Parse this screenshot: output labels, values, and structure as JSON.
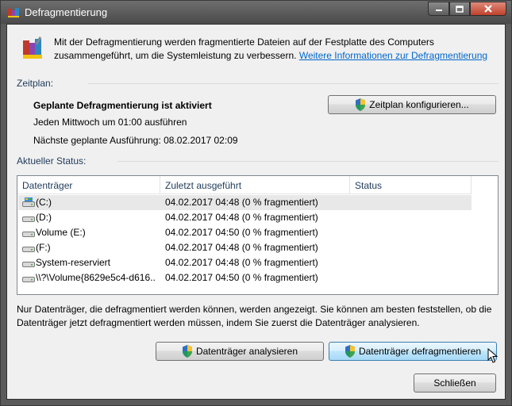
{
  "window": {
    "title": "Defragmentierung",
    "minimize_label": "minimize",
    "maximize_label": "maximize",
    "close_label": "close"
  },
  "intro": {
    "text_line1": "Mit der Defragmentierung werden fragmentierte Dateien auf der Festplatte des Computers",
    "text_line2": "zusammengeführt, um die Systemleistung zu verbessern.",
    "link": "Weitere Informationen zur Defragmentierung"
  },
  "schedule": {
    "section_label": "Zeitplan:",
    "status_heading": "Geplante Defragmentierung ist aktiviert",
    "frequency": "Jeden Mittwoch um 01:00 ausführen",
    "next_run": "Nächste geplante Ausführung: 08.02.2017 02:09",
    "configure_button": "Zeitplan konfigurieren..."
  },
  "status": {
    "section_label": "Aktueller Status:",
    "columns": [
      "Datenträger",
      "Zuletzt ausgeführt",
      "Status"
    ],
    "rows": [
      {
        "name": "(C:)",
        "last_run": "04.02.2017 04:48 (0 % fragmentiert)",
        "status": "",
        "icon": "system-drive-icon"
      },
      {
        "name": "(D:)",
        "last_run": "04.02.2017 04:48 (0 % fragmentiert)",
        "status": "",
        "icon": "drive-icon"
      },
      {
        "name": "Volume (E:)",
        "last_run": "04.02.2017 04:50 (0 % fragmentiert)",
        "status": "",
        "icon": "drive-icon"
      },
      {
        "name": "(F:)",
        "last_run": "04.02.2017 04:48 (0 % fragmentiert)",
        "status": "",
        "icon": "drive-icon"
      },
      {
        "name": "System-reserviert",
        "last_run": "04.02.2017 04:48 (0 % fragmentiert)",
        "status": "",
        "icon": "drive-icon"
      },
      {
        "name": "\\\\?\\Volume{8629e5c4-d616...",
        "last_run": "04.02.2017 04:50 (0 % fragmentiert)",
        "status": "",
        "icon": "drive-icon"
      }
    ]
  },
  "note": {
    "line1": "Nur Datenträger, die defragmentiert werden können, werden angezeigt. Sie können am besten feststellen, ob die",
    "line2": "Datenträger jetzt defragmentiert werden müssen, indem Sie zuerst die Datenträger analysieren."
  },
  "actions": {
    "analyze_button": "Datenträger analysieren",
    "defrag_button": "Datenträger defragmentieren",
    "close_button": "Schließen"
  }
}
